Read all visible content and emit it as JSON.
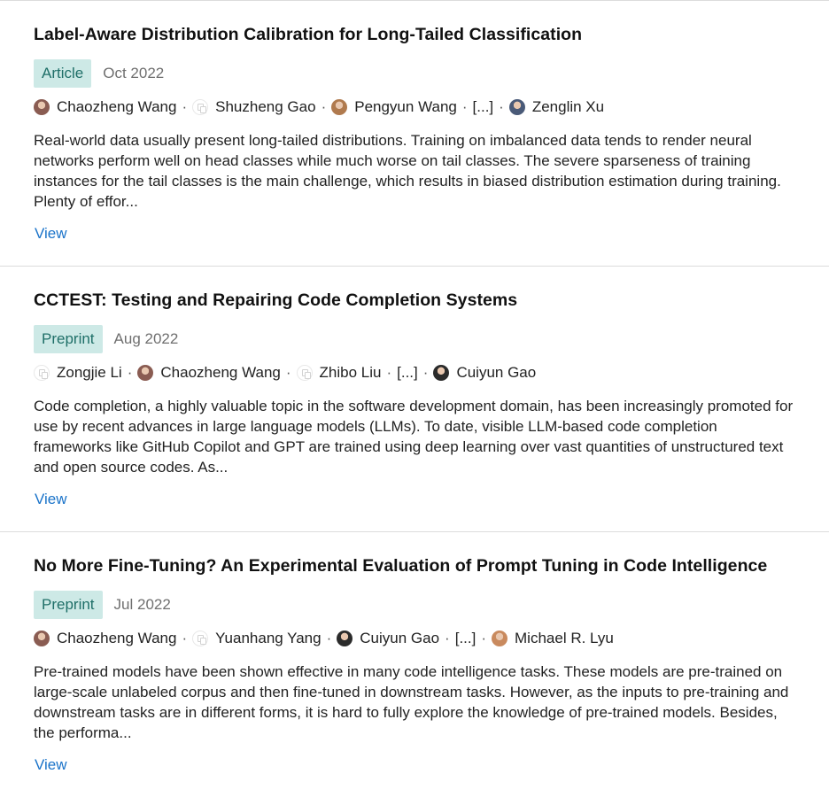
{
  "publications": [
    {
      "title": "Label-Aware Distribution Calibration for Long-Tailed Classification",
      "type": "Article",
      "date": "Oct 2022",
      "authors": [
        {
          "name": "Chaozheng Wang",
          "avatar": "photo",
          "color": "#8a5c52"
        },
        {
          "name": "Shuzheng Gao",
          "avatar": "placeholder"
        },
        {
          "name": "Pengyun Wang",
          "avatar": "photo",
          "color": "#b07a4e"
        },
        {
          "name": "[...]",
          "avatar": "none"
        },
        {
          "name": "Zenglin Xu",
          "avatar": "photo",
          "color": "#4a5a78"
        }
      ],
      "abstract": "Real-world data usually present long-tailed distributions. Training on imbalanced data tends to render neural networks perform well on head classes while much worse on tail classes. The severe sparseness of training instances for the tail classes is the main challenge, which results in biased distribution estimation during training. Plenty of effor...",
      "view_label": "View"
    },
    {
      "title": "CCTEST: Testing and Repairing Code Completion Systems",
      "type": "Preprint",
      "date": "Aug 2022",
      "authors": [
        {
          "name": "Zongjie Li",
          "avatar": "placeholder"
        },
        {
          "name": "Chaozheng Wang",
          "avatar": "photo",
          "color": "#8a5c52"
        },
        {
          "name": "Zhibo Liu",
          "avatar": "placeholder"
        },
        {
          "name": "[...]",
          "avatar": "none"
        },
        {
          "name": "Cuiyun Gao",
          "avatar": "photo",
          "color": "#2b2b2b"
        }
      ],
      "abstract": "Code completion, a highly valuable topic in the software development domain, has been increasingly promoted for use by recent advances in large language models (LLMs). To date, visible LLM-based code completion frameworks like GitHub Copilot and GPT are trained using deep learning over vast quantities of unstructured text and open source codes. As...",
      "view_label": "View"
    },
    {
      "title": "No More Fine-Tuning? An Experimental Evaluation of Prompt Tuning in Code Intelligence",
      "type": "Preprint",
      "date": "Jul 2022",
      "authors": [
        {
          "name": "Chaozheng Wang",
          "avatar": "photo",
          "color": "#8a5c52"
        },
        {
          "name": "Yuanhang Yang",
          "avatar": "placeholder"
        },
        {
          "name": "Cuiyun Gao",
          "avatar": "photo",
          "color": "#2b2b2b"
        },
        {
          "name": "[...]",
          "avatar": "none"
        },
        {
          "name": "Michael R. Lyu",
          "avatar": "photo",
          "color": "#c98a5e"
        }
      ],
      "abstract": "Pre-trained models have been shown effective in many code intelligence tasks. These models are pre-trained on large-scale unlabeled corpus and then fine-tuned in downstream tasks. However, as the inputs to pre-training and downstream tasks are in different forms, it is hard to fully explore the knowledge of pre-trained models. Besides, the performa...",
      "view_label": "View"
    }
  ],
  "separator": "·"
}
